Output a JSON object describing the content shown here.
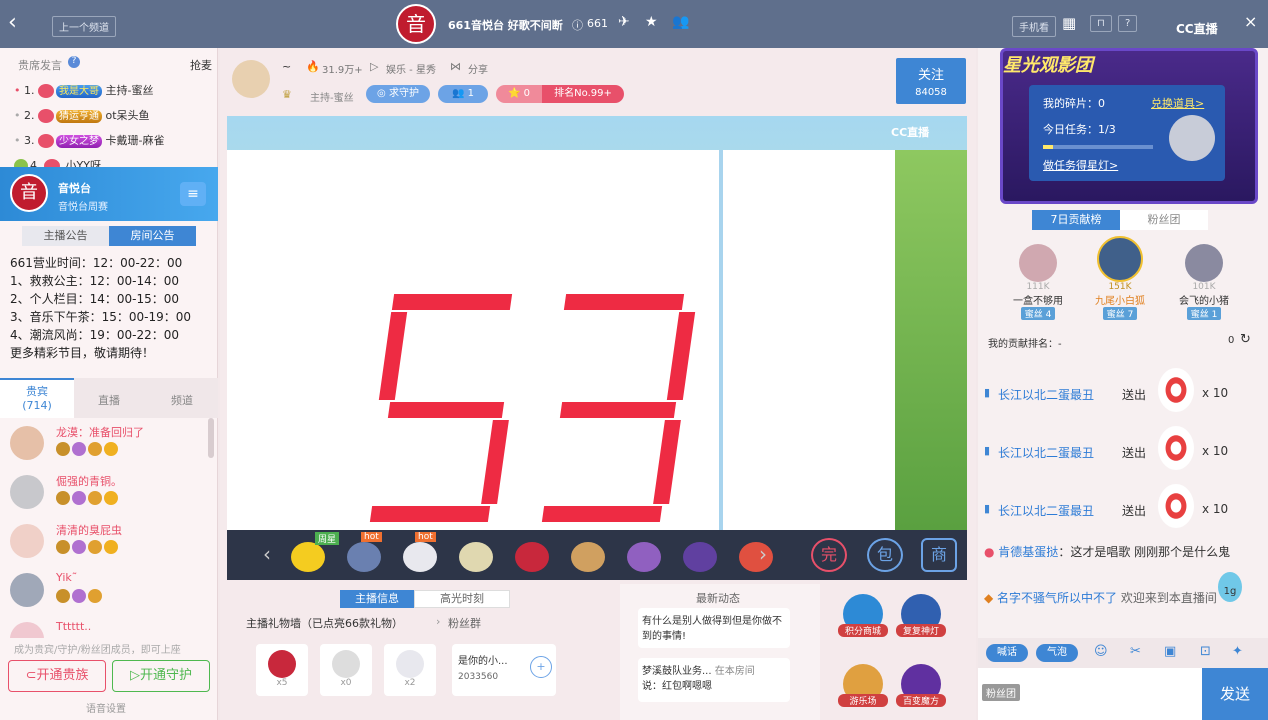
{
  "topbar": {
    "back": "‹",
    "prev_channel": "上一个频道",
    "channel_title": "661音悦台 好歌不间断",
    "channel_id": "661",
    "phone": "手机看",
    "close": "×",
    "cc_logo": "CC直播"
  },
  "left": {
    "seat_title": "贵席发言",
    "grab": "抢麦",
    "rank": [
      {
        "n": "1.",
        "tag": "我是大哥",
        "name": "主持-蜜丝"
      },
      {
        "n": "2.",
        "tag": "猜运亨通",
        "name": "ot呆头鱼"
      },
      {
        "n": "3.",
        "tag": "少女之梦",
        "name": "卡戴珊-麻雀"
      },
      {
        "n": "4.",
        "tag": "",
        "name": "小YY呀"
      }
    ],
    "room_name": "音悦台",
    "room_sub": "音悦台周赛",
    "tabs": [
      "主播公告",
      "房间公告"
    ],
    "notice": [
      "661营业时间：12：00-22：00",
      "1、救救公主：12：00-14：00",
      "2、个人栏目：14：00-15：00",
      "3、音乐下午茶：15：00-19：00",
      "4、潮流风尚：19：00-22：00",
      "更多精彩节目，敬请期待！"
    ],
    "user_tabs": [
      "贵宾",
      "直播",
      "频道"
    ],
    "vip_count": "(714)",
    "users": [
      {
        "name": "龙漠：准备回归了"
      },
      {
        "name": "倔强的青铜。"
      },
      {
        "name": "清清的臭屁虫"
      },
      {
        "name": "Yik˜"
      },
      {
        "name": "Tttttt.."
      }
    ],
    "become": "成为贵宾/守护/粉丝团成员，即可上座",
    "open_noble": "开通贵族",
    "open_guard": "开通守护",
    "voice_settings": "语音设置"
  },
  "center": {
    "tilde": "~",
    "heat": "31.9万+",
    "category": "娱乐 - 星秀",
    "share": "分享",
    "host": "主持-蜜丝",
    "guard": "求守护",
    "fans": "1",
    "gift_count": "0",
    "rank": "排名No.99+",
    "follow": "关注",
    "follow_count": "84058",
    "number": "53",
    "cc_watermark": "CC直播",
    "gift_tags": [
      "周星",
      "hot",
      "hot"
    ],
    "info_tabs": [
      "主播信息",
      "高光时刻"
    ],
    "news_tab": "最新动态",
    "wall": "主播礼物墙（已点亮66款礼物）",
    "fan_group": "粉丝群",
    "gift_counts": [
      "x5",
      "x0",
      "x2"
    ],
    "wish": "是你的小...",
    "wish_num": "2033560",
    "news": [
      {
        "text": "有什么是别人做得到但是你做不到的事情!"
      },
      {
        "a": "梦溪鼓队业务...",
        "b": "在本房间",
        "c": "说：红包啊嗯嗯"
      }
    ],
    "icons": [
      "积分商城",
      "复复神灯",
      "游乐场",
      "百变魔方"
    ]
  },
  "right": {
    "banner": "星光观影团",
    "fragments": "我的碎片：0",
    "redeem": "兑换道具>",
    "task": "今日任务：1/3",
    "do_task": "做任务得星灯>",
    "tabs": [
      "7日贡献榜",
      "粉丝团"
    ],
    "top3": [
      {
        "score": "111K",
        "name": "一盒不够用",
        "lvl": "蜜丝",
        "n": "4"
      },
      {
        "score": "151K",
        "name": "九尾小白狐",
        "lvl": "蜜丝",
        "n": "7"
      },
      {
        "score": "101K",
        "name": "会飞的小猪",
        "lvl": "蜜丝",
        "n": "1"
      }
    ],
    "my_rank": "我的贡献排名：-",
    "my_val": "0",
    "gifts": [
      {
        "user": "长江以北二蛋最丑",
        "action": "送出",
        "count": "x 10"
      },
      {
        "user": "长江以北二蛋最丑",
        "action": "送出",
        "count": "x 10"
      },
      {
        "user": "长江以北二蛋最丑",
        "action": "送出",
        "count": "x 10"
      }
    ],
    "chat1_user": "肯德基蛋挞",
    "chat1_text": "：这才是唱歌 刚刚那个是什么鬼",
    "chat2_user": "名字不骚气所以中不了",
    "chat2_text": "欢迎来到本直播间",
    "btn_shout": "喊话",
    "btn_bubble": "气泡",
    "fans_label": "粉丝团",
    "send": "发送",
    "weight": "1g"
  },
  "colors": {
    "accent": "#e8506a",
    "topbar": "#5f6f8c",
    "blue": "#2d7bd6",
    "number": "#ee2b43"
  }
}
